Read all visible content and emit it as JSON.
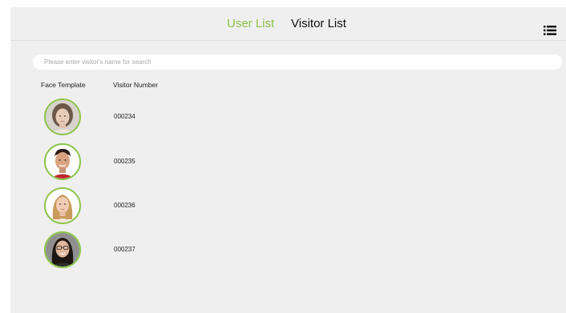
{
  "header": {
    "tabs": [
      {
        "label": "User List",
        "active": true
      },
      {
        "label": "Visitor List",
        "active": false
      }
    ],
    "menu_icon": "list-icon",
    "accent_color": "#8bc34a"
  },
  "search": {
    "placeholder": "Please enter visitor's name for search",
    "value": ""
  },
  "table": {
    "columns": [
      "Face Template",
      "Visitor Number"
    ],
    "rows": [
      {
        "face": "face-photo-icon",
        "number": "000234"
      },
      {
        "face": "face-photo-icon",
        "number": "000235"
      },
      {
        "face": "face-photo-icon",
        "number": "000236"
      },
      {
        "face": "face-photo-icon",
        "number": "000237"
      }
    ]
  }
}
